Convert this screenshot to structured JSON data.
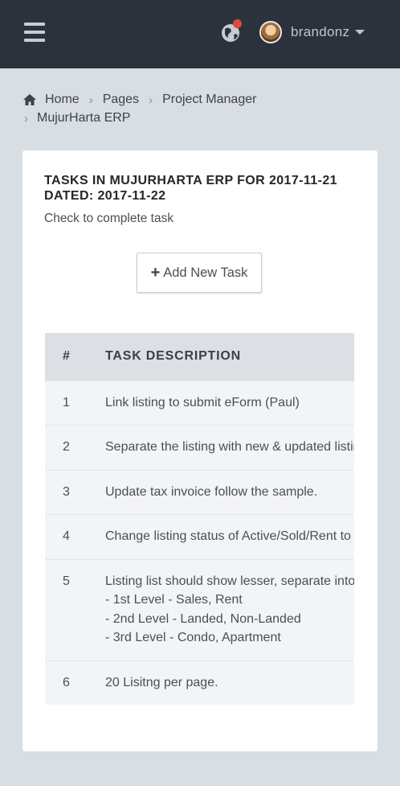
{
  "header": {
    "username": "brandonz",
    "icons": {
      "menu": "hamburger-icon",
      "notifications": "globe-icon",
      "account": "avatar",
      "dropdown": "caret-down-icon"
    },
    "accent_badge_color": "#e0473e"
  },
  "breadcrumb": {
    "home": "Home",
    "pages": "Pages",
    "project_manager": "Project Manager",
    "current": "MujurHarta ERP"
  },
  "card": {
    "title_line1": "TASKS IN MUJURHARTA ERP FOR 2017-11-21",
    "title_line2": "DATED: 2017-11-22",
    "subtitle": "Check to complete task",
    "add_button": "Add New Task"
  },
  "table": {
    "headers": {
      "num": "#",
      "desc": "TASK DESCRIPTION"
    },
    "rows": [
      {
        "num": "1",
        "desc": "Link listing to submit eForm (Paul)"
      },
      {
        "num": "2",
        "desc": "Separate the listing with new & updated listing"
      },
      {
        "num": "3",
        "desc": "Update tax invoice follow the sample."
      },
      {
        "num": "4",
        "desc": "Change listing status of Active/Sold/Rent to"
      },
      {
        "num": "5",
        "desc": "Listing list should show lesser, separate into",
        "sub1": "- 1st Level - Sales, Rent",
        "sub2": "- 2nd Level - Landed, Non-Landed",
        "sub3": "- 3rd Level - Condo, Apartment"
      },
      {
        "num": "6",
        "desc": "20 Lisitng per page."
      }
    ]
  }
}
